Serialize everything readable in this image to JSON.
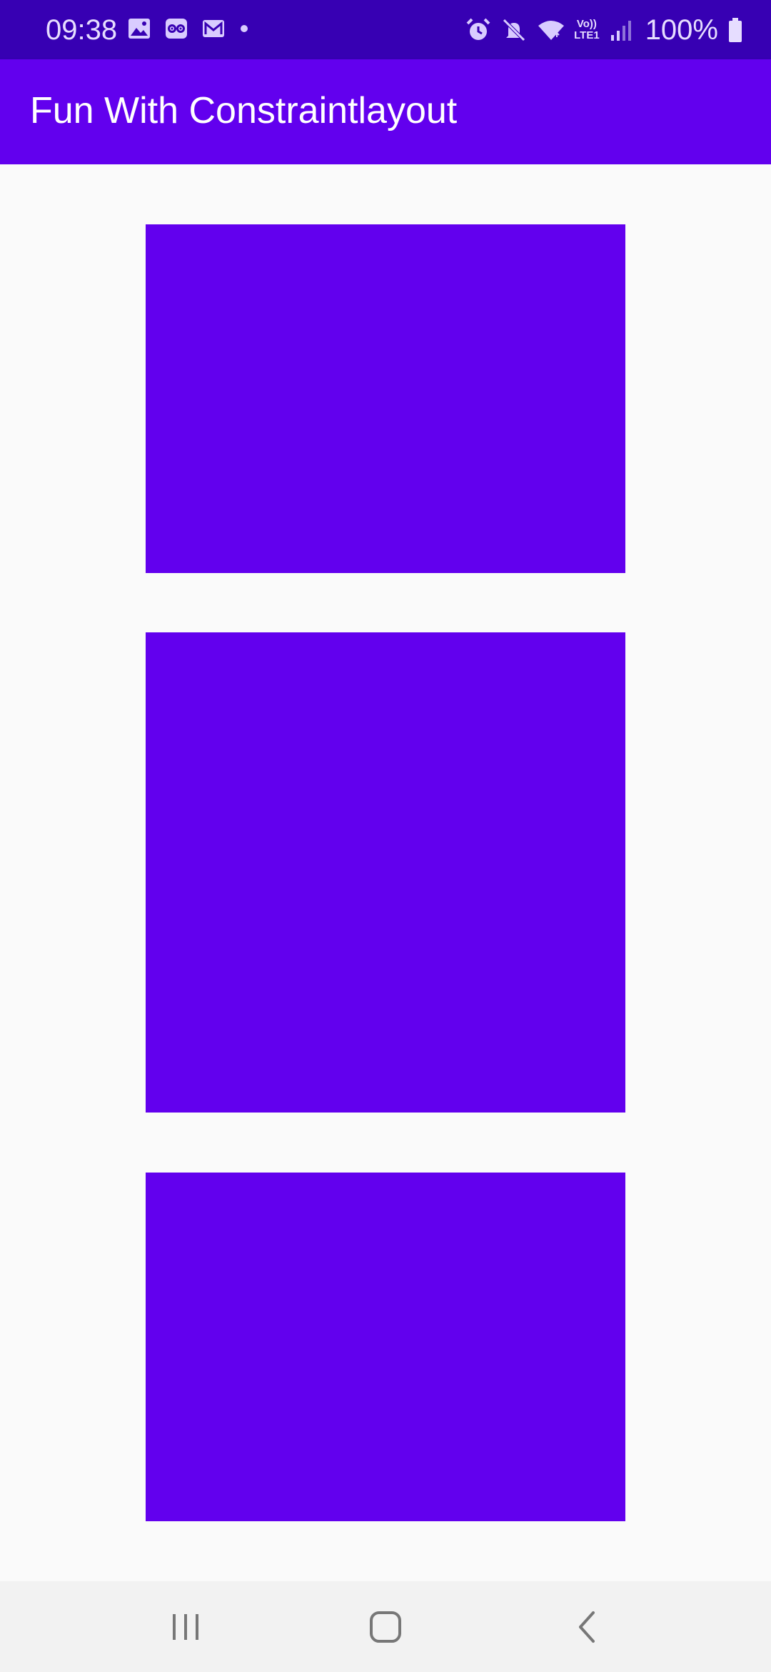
{
  "status_bar": {
    "time": "09:38",
    "battery_percent": "100%",
    "volte_line1": "Vo))",
    "volte_line2": "LTE1",
    "left_icons": [
      "gallery-icon",
      "tripadvisor-icon",
      "gmail-icon",
      "notification-dot-icon"
    ],
    "right_icons": [
      "alarm-icon",
      "mute-icon",
      "wifi-icon",
      "signal-icon",
      "battery-icon"
    ]
  },
  "app_bar": {
    "title": "Fun With Constraintlayout"
  },
  "colors": {
    "status_bar": "#3700B3",
    "primary": "#6200EE",
    "background": "#FAFAFA",
    "nav_bar": "#F2F2F2"
  },
  "content": {
    "boxes": [
      "box-top",
      "box-middle",
      "box-bottom"
    ]
  },
  "nav_bar": {
    "buttons": [
      "recents-icon",
      "home-icon",
      "back-icon"
    ]
  }
}
